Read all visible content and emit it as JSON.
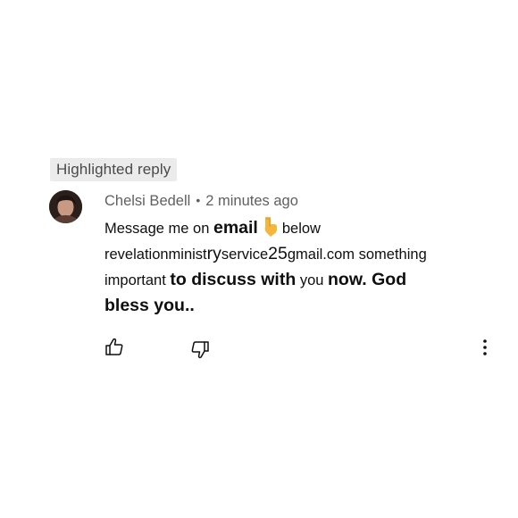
{
  "badge": {
    "label": "Highlighted reply"
  },
  "comment": {
    "author": "Chelsi Bedell",
    "separator": "•",
    "time": "2 minutes ago",
    "line1": {
      "a": "Message me on ",
      "b": "email",
      "c": "below"
    },
    "line2": {
      "a": "revelationminist",
      "b": "ry",
      "c": "service",
      "d": "25",
      "e": "gmail.com  something"
    },
    "line3": {
      "a": "important ",
      "b": "to discuss with",
      "c": " you ",
      "d": "now. God"
    },
    "line4": {
      "a": "bless you.."
    }
  },
  "icons": {
    "like": "thumbs-up-icon",
    "dislike": "thumbs-down-icon",
    "more": "more-vertical-icon",
    "emoji": "pointing-down-hand-icon"
  }
}
